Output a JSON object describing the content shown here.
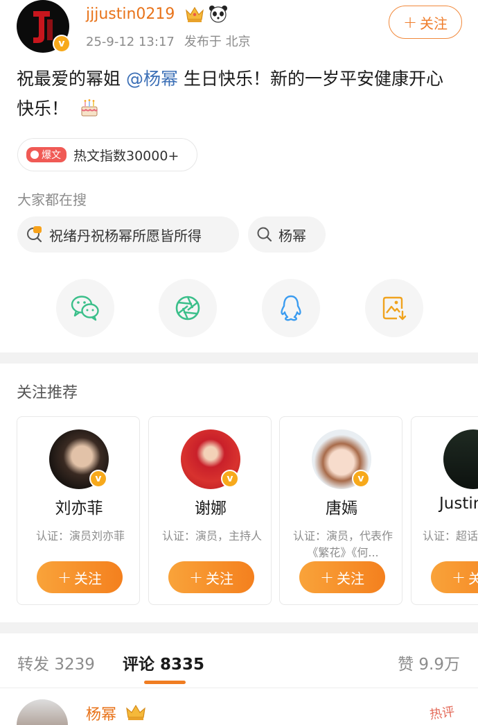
{
  "post": {
    "username": "jjjustin0219",
    "time": "25-9-12 13:17",
    "location": "发布于 北京",
    "follow_label": "关注",
    "text_before": "祝最爱的幂姐",
    "mention": "@杨幂",
    "text_after": "生日快乐！新的一岁平安健康开心快乐！",
    "hot_tag": "爆文",
    "hot_text": "热文指数30000+"
  },
  "search": {
    "title": "大家都在搜",
    "chips": [
      "祝绪丹祝杨幂所愿皆所得",
      "杨幂"
    ]
  },
  "share": {
    "icons": [
      "wechat-icon",
      "moments-icon",
      "qq-icon",
      "save-image-icon"
    ]
  },
  "recommend": {
    "title": "关注推荐",
    "follow_label": "关注",
    "cards": [
      {
        "name": "刘亦菲",
        "desc": "认证：演员刘亦菲"
      },
      {
        "name": "谢娜",
        "desc": "认证：演员，主持人"
      },
      {
        "name": "唐嫣",
        "desc": "认证：演员，代表作《繁花》《何..."
      },
      {
        "name": "Justin",
        "desc": "认证：超话人（黄明昊"
      }
    ]
  },
  "tabs": {
    "repost_label": "转发",
    "repost_count": "3239",
    "comment_label": "评论",
    "comment_count": "8335",
    "like_label": "赞",
    "like_count": "9.9万"
  },
  "comment": {
    "username": "杨幂",
    "watermark": "热评"
  },
  "colors": {
    "accent_orange": "#f07d22",
    "link_blue": "#3b6fb6",
    "hot_red": "#f05a55"
  }
}
